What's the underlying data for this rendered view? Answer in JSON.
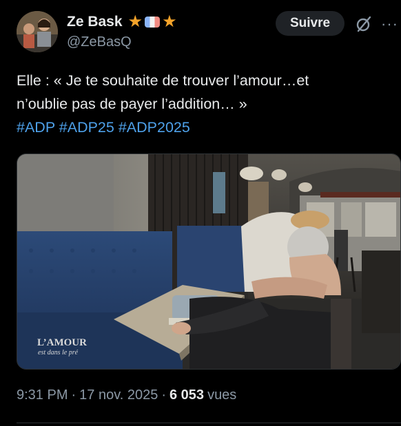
{
  "author": {
    "name": "Ze Bask",
    "handle": "@ZeBasQ",
    "badges": [
      "star-icon",
      "flag-badge-icon",
      "star-icon"
    ]
  },
  "actions": {
    "follow_label": "Suivre",
    "grok_icon": "grok-icon",
    "more_icon": "more-options-icon",
    "more_glyph": "···"
  },
  "tweet": {
    "line1": "Elle : « Je te souhaite de trouver l’amour…et",
    "line2": "n’oublie pas de payer l’addition… »",
    "hashtags": [
      "#ADP",
      "#ADP25",
      "#ADP2025"
    ]
  },
  "media": {
    "watermark_line1": "L’AMOUR",
    "watermark_line2": "est dans le pré"
  },
  "meta": {
    "time": "9:31 PM",
    "separator": "·",
    "date": "17 nov. 2025",
    "views_count": "6 053",
    "views_label": "vues"
  },
  "colors": {
    "background": "#000000",
    "hashtag": "#4ea1ea",
    "secondary_text": "#8b98a5",
    "star": "#f4a32a"
  }
}
